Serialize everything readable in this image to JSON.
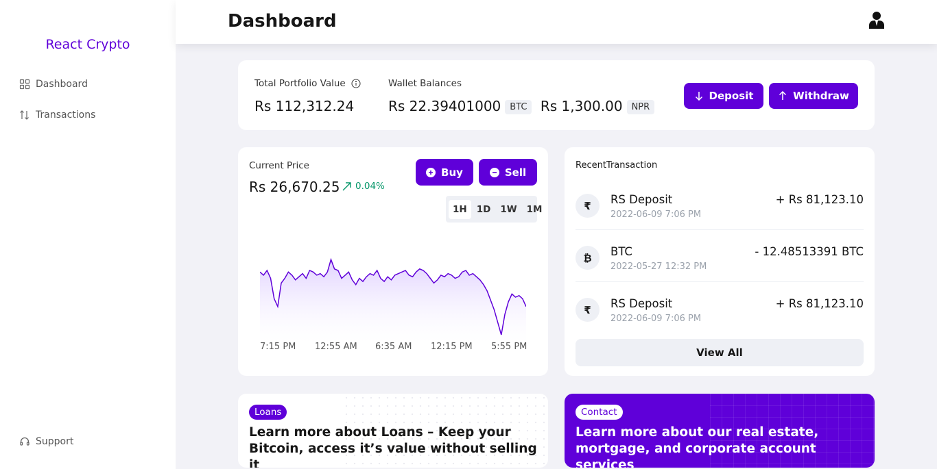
{
  "sidebar": {
    "brand": "React Crypto",
    "items": [
      {
        "label": "Dashboard",
        "icon": "grid-icon"
      },
      {
        "label": "Transactions",
        "icon": "arrows-up-down-icon"
      }
    ],
    "support": {
      "label": "Support",
      "icon": "headset-icon"
    }
  },
  "header": {
    "title": "Dashboard",
    "user_icon": "user-icon"
  },
  "portfolio": {
    "total_label": "Total Portfolio Value",
    "total_value": "Rs 112,312.24",
    "wallet_label": "Wallet Balances",
    "btc_value": "Rs 22.39401000",
    "btc_tag": "BTC",
    "npr_value": "Rs 1,300.00",
    "npr_tag": "NPR",
    "deposit_label": "Deposit",
    "withdraw_label": "Withdraw"
  },
  "price": {
    "label": "Current Price",
    "value": "Rs 26,670.25",
    "change": "0.04%",
    "buy_label": "Buy",
    "sell_label": "Sell",
    "ranges": [
      "1H",
      "1D",
      "1W",
      "1M"
    ],
    "active_range": "1H"
  },
  "chart_data": {
    "type": "area",
    "x_tick_labels": [
      "7:15 PM",
      "12:55 AM",
      "6:35 AM",
      "12:15 PM",
      "5:55 PM"
    ],
    "values": [
      62,
      60,
      63,
      58,
      45,
      40,
      55,
      58,
      62,
      60,
      57,
      59,
      61,
      58,
      63,
      62,
      60,
      61,
      59,
      62,
      70,
      64,
      63,
      58,
      60,
      62,
      57,
      54,
      58,
      56,
      59,
      61,
      60,
      63,
      58,
      56,
      59,
      57,
      60,
      61,
      62,
      63,
      60,
      59,
      62,
      64,
      63,
      61,
      58,
      55,
      57,
      60,
      59,
      61,
      60,
      58,
      59,
      62,
      63,
      60,
      61,
      59,
      57,
      54,
      50,
      44,
      38,
      30,
      22,
      35,
      43,
      48,
      46,
      47,
      45,
      40
    ],
    "colors": {
      "line": "#5f00d9",
      "fill": "#ede4ff"
    }
  },
  "transactions": {
    "title": "RecentTransaction",
    "items": [
      {
        "icon": "₹",
        "name": "RS Deposit",
        "date": "2022-06-09 7:06 PM",
        "amount": "+ Rs 81,123.10"
      },
      {
        "icon": "₿",
        "name": "BTC",
        "date": "2022-05-27 12:32 PM",
        "amount": "- 12.48513391 BTC"
      },
      {
        "icon": "₹",
        "name": "RS Deposit",
        "date": "2022-06-09 7:06 PM",
        "amount": "+ Rs 81,123.10"
      }
    ],
    "view_all": "View All"
  },
  "promos": {
    "loans": {
      "tag": "Loans",
      "text": "Learn more about Loans – Keep your Bitcoin, access it’s value without selling it"
    },
    "contact": {
      "tag": "Contact",
      "text": "Learn more about our real estate, mortgage, and corporate account services"
    }
  },
  "colors": {
    "accent": "#5f00d9",
    "positive": "#059669",
    "background": "#f2f2f7"
  }
}
